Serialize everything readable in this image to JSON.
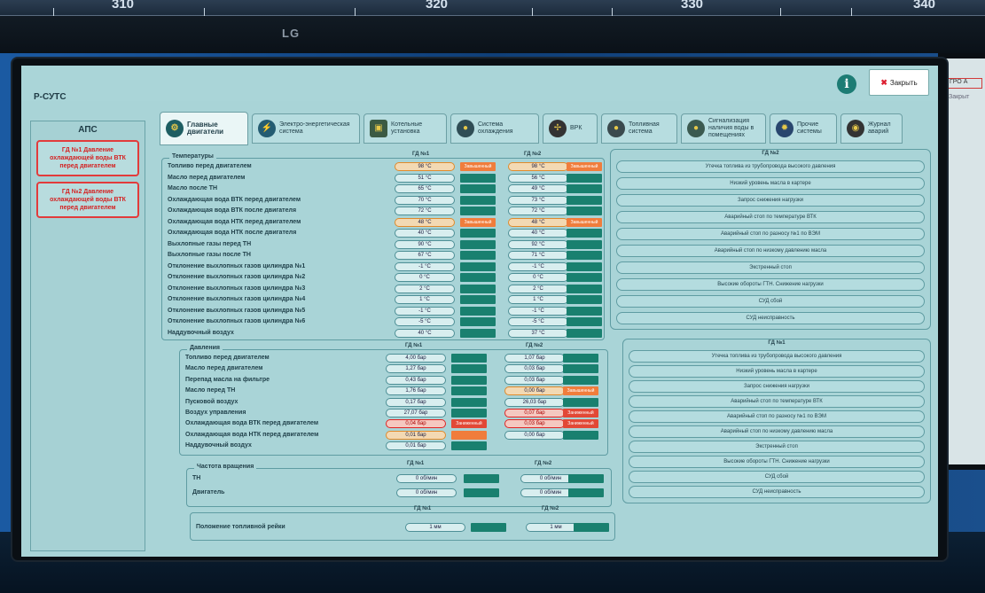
{
  "scale": {
    "numbers": [
      "310",
      "320",
      "330",
      "340"
    ]
  },
  "monitor": {
    "brand": "LG"
  },
  "side_screen": {
    "badge": "ГРО А",
    "text": "Закрыт"
  },
  "app": {
    "title": "Р-СУТС",
    "info_icon": "info-icon",
    "close_label": "Закрыть"
  },
  "aps": {
    "title": "АПС",
    "alarms": [
      "ГД №1 Давление охлаждающей воды ВТК перед двигателем",
      "ГД №2 Давление охлаждающей воды ВТК перед двигателем"
    ]
  },
  "tabs": [
    {
      "label": "Главные двигатели",
      "icon": "engine-icon"
    },
    {
      "label": "Электро-энергетическая система",
      "icon": "lightning-icon"
    },
    {
      "label": "Котельные установка",
      "icon": "boiler-icon"
    },
    {
      "label": "Система охлаждения",
      "icon": "cooling-icon"
    },
    {
      "label": "ВРК",
      "icon": "propeller-icon"
    },
    {
      "label": "Топливная система",
      "icon": "fuel-icon"
    },
    {
      "label": "Сигнализация наличия воды в помещениях",
      "icon": "water-icon"
    },
    {
      "label": "Прочие системы",
      "icon": "gear-icon"
    },
    {
      "label": "Журнал аварий",
      "icon": "log-icon"
    }
  ],
  "temperature": {
    "legend": "Температуры",
    "gd1": "ГД №1",
    "gd2": "ГД №2",
    "rows": [
      {
        "label": "Топливо перед двигателем",
        "v1": "98 °C",
        "s1": "warn",
        "t1": "Завышенный",
        "v2": "98 °C",
        "s2": "warn",
        "t2": "Завышенный"
      },
      {
        "label": "Масло перед двигателем",
        "v1": "51 °C",
        "s1": "ok",
        "t1": "",
        "v2": "56 °C",
        "s2": "ok",
        "t2": ""
      },
      {
        "label": "Масло после ТН",
        "v1": "65 °C",
        "s1": "ok",
        "t1": "",
        "v2": "49 °C",
        "s2": "ok",
        "t2": ""
      },
      {
        "label": "Охлаждающая вода ВТК перед двигателем",
        "v1": "70 °C",
        "s1": "ok",
        "t1": "",
        "v2": "73 °C",
        "s2": "ok",
        "t2": ""
      },
      {
        "label": "Охлаждающая вода ВТК после двигателя",
        "v1": "72 °C",
        "s1": "ok",
        "t1": "",
        "v2": "72 °C",
        "s2": "ok",
        "t2": ""
      },
      {
        "label": "Охлаждающая вода НТК перед двигателем",
        "v1": "48 °C",
        "s1": "warn",
        "t1": "Завышенный",
        "v2": "48 °C",
        "s2": "warn",
        "t2": "Завышенный"
      },
      {
        "label": "Охлаждающая вода НТК после двигателя",
        "v1": "40 °C",
        "s1": "ok",
        "t1": "",
        "v2": "40 °C",
        "s2": "ok",
        "t2": ""
      },
      {
        "label": "Выхлопные газы перед ТН",
        "v1": "90 °C",
        "s1": "ok",
        "t1": "",
        "v2": "92 °C",
        "s2": "ok",
        "t2": ""
      },
      {
        "label": "Выхлопные газы после ТН",
        "v1": "67 °C",
        "s1": "ok",
        "t1": "",
        "v2": "71 °C",
        "s2": "ok",
        "t2": ""
      },
      {
        "label": "Отклонение выхлопных газов цилиндра №1",
        "v1": "-1 °C",
        "s1": "ok",
        "t1": "",
        "v2": "-1 °C",
        "s2": "ok",
        "t2": ""
      },
      {
        "label": "Отклонение выхлопных газов цилиндра №2",
        "v1": "0 °C",
        "s1": "ok",
        "t1": "",
        "v2": "0 °C",
        "s2": "ok",
        "t2": ""
      },
      {
        "label": "Отклонение выхлопных газов цилиндра №3",
        "v1": "2 °C",
        "s1": "ok",
        "t1": "",
        "v2": "2 °C",
        "s2": "ok",
        "t2": ""
      },
      {
        "label": "Отклонение выхлопных газов цилиндра №4",
        "v1": "1 °C",
        "s1": "ok",
        "t1": "",
        "v2": "1 °C",
        "s2": "ok",
        "t2": ""
      },
      {
        "label": "Отклонение выхлопных газов цилиндра №5",
        "v1": "-1 °C",
        "s1": "ok",
        "t1": "",
        "v2": "-1 °C",
        "s2": "ok",
        "t2": ""
      },
      {
        "label": "Отклонение выхлопных газов цилиндра №6",
        "v1": "-5 °C",
        "s1": "ok",
        "t1": "",
        "v2": "-5 °C",
        "s2": "ok",
        "t2": ""
      },
      {
        "label": "Наддувочный воздух",
        "v1": "40 °C",
        "s1": "ok",
        "t1": "",
        "v2": "37 °C",
        "s2": "ok",
        "t2": ""
      }
    ]
  },
  "pressure": {
    "legend": "Давления",
    "gd1": "ГД №1",
    "gd2": "ГД №2",
    "rows": [
      {
        "label": "Топливо перед двигателем",
        "v1": "4,00 бар",
        "s1": "ok",
        "t1": "",
        "v2": "1,07 бар",
        "s2": "ok",
        "t2": ""
      },
      {
        "label": "Масло перед двигателем",
        "v1": "1,27 бар",
        "s1": "ok",
        "t1": "",
        "v2": "0,03 бар",
        "s2": "ok",
        "t2": ""
      },
      {
        "label": "Перепад масла на фильтре",
        "v1": "0,43 бар",
        "s1": "ok",
        "t1": "",
        "v2": "0,03 бар",
        "s2": "ok",
        "t2": ""
      },
      {
        "label": "Масло перед ТН",
        "v1": "1,76 бар",
        "s1": "ok",
        "t1": "",
        "v2": "0,00 бар",
        "s2": "warn",
        "t2": "Завышенный"
      },
      {
        "label": "Пусковой воздух",
        "v1": "0,17 бар",
        "s1": "ok",
        "t1": "",
        "v2": "26,03 бар",
        "s2": "ok",
        "t2": ""
      },
      {
        "label": "Воздух управления",
        "v1": "27,07 бар",
        "s1": "ok",
        "t1": "",
        "v2": "0,07 бар",
        "s2": "alarm",
        "t2": "Заниженный"
      },
      {
        "label": "Охлаждающая вода ВТК перед двигателем",
        "v1": "0,04 бар",
        "s1": "alarm",
        "t1": "Заниженный",
        "v2": "0,03 бар",
        "s2": "alarm",
        "t2": "Заниженный"
      },
      {
        "label": "Охлаждающая вода НТК перед двигателем",
        "v1": "0,01 бар",
        "s1": "warn",
        "t1": "",
        "v2": "0,00 бар",
        "s2": "ok",
        "t2": ""
      },
      {
        "label": "Наддувочный воздух",
        "v1": "0,01 бар",
        "s1": "ok",
        "t1": "",
        "v2": "",
        "s2": "none",
        "t2": ""
      }
    ]
  },
  "rpm": {
    "legend": "Частота вращения",
    "gd1": "ГД №1",
    "gd2": "ГД №2",
    "rows": [
      {
        "label": "ТН",
        "v1": "0 об/мин",
        "v2": "0 об/мин"
      },
      {
        "label": "Двигатель",
        "v1": "0 об/мин",
        "v2": "0 об/мин"
      }
    ]
  },
  "fuel_rack": {
    "gd1": "ГД №1",
    "gd2": "ГД №2",
    "label": "Положение топливной рейки",
    "v1": "1 мм",
    "v2": "1 мм"
  },
  "signals_gd2": {
    "title": "ГД №2",
    "items": [
      "Утечка топлива из трубопровода высокого давления",
      "Низкий уровень масла в картере",
      "Запрос снижения нагрузки",
      "Аварийный стоп по температуре ВТК",
      "Аварийный стоп по разносу №1 по ВЭМ",
      "Аварийный стоп по низкому давлению масла",
      "Экстренный стоп",
      "Высокие обороты ГТН. Снижение нагрузки",
      "СУД сбой",
      "СУД неисправность"
    ]
  },
  "signals_gd1": {
    "title": "ГД №1",
    "items": [
      "Утечка топлива из трубопровода высокого давления",
      "Низкий уровень масла в картере",
      "Запрос снижения нагрузки",
      "Аварийный стоп по температуре ВТК",
      "Аварийный стоп по разносу №1 по ВЭМ",
      "Аварийный стоп по низкому давлению масла",
      "Экстренный стоп",
      "Высокие обороты ГТН. Снижение нагрузки",
      "СУД сбой",
      "СУД неисправность"
    ]
  },
  "colors": {
    "screen_bg": "#a9d4d7",
    "status_ok": "#19806f",
    "status_warn": "#f07d3c",
    "status_alarm": "#e24836",
    "alarm_text": "#d42222"
  }
}
